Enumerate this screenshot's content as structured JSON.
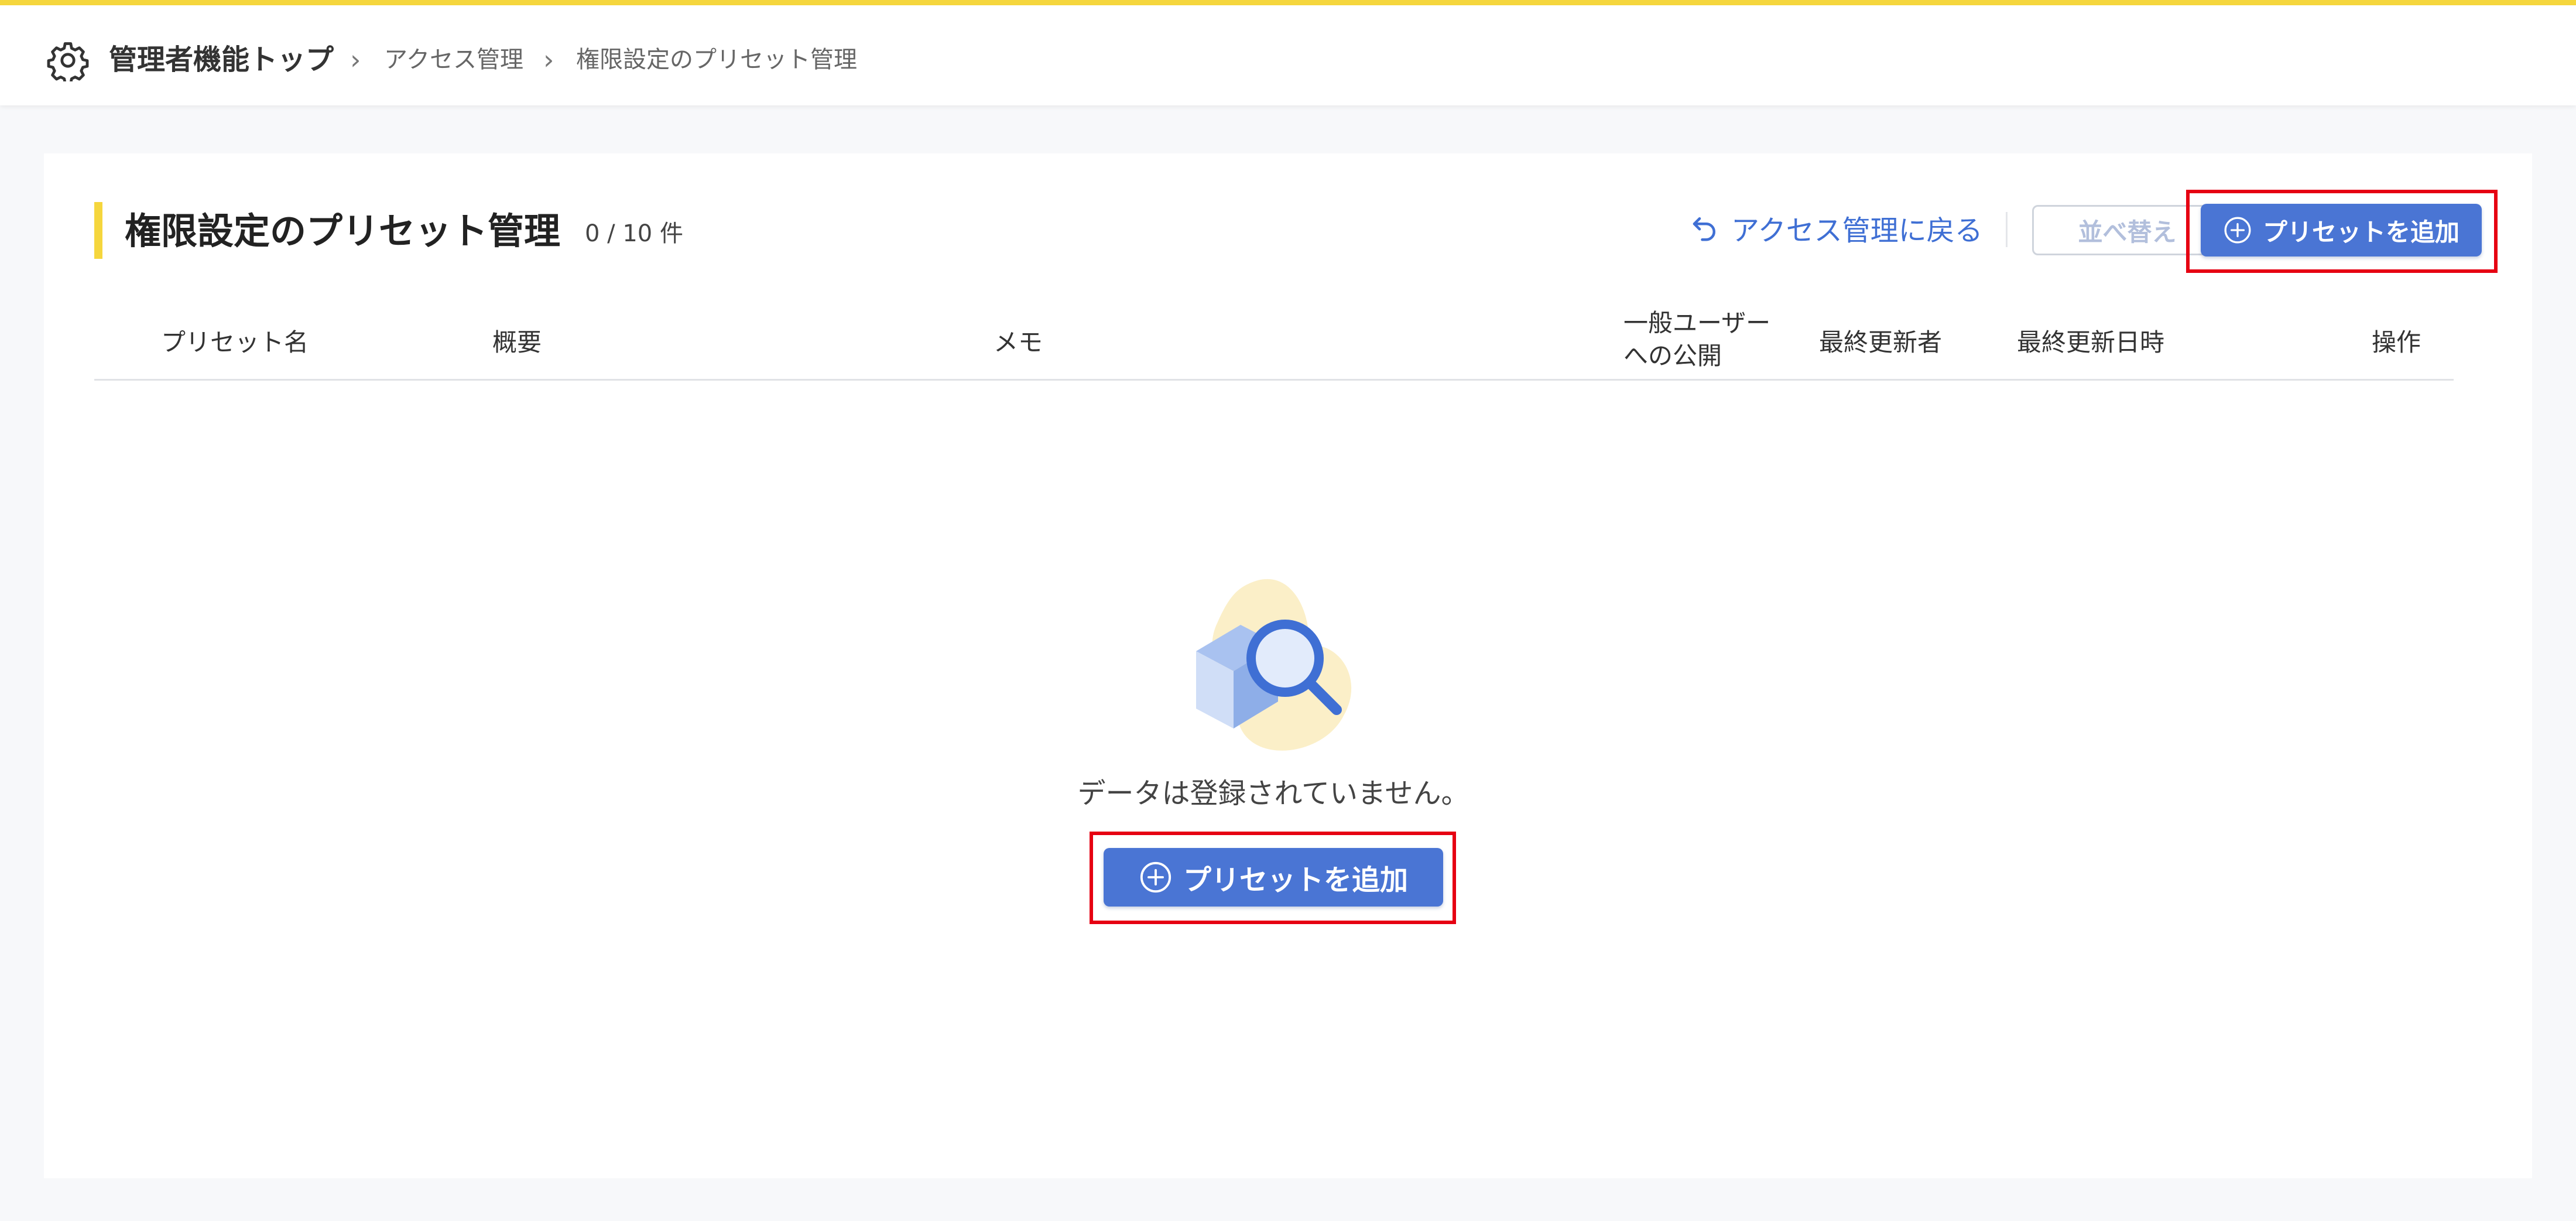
{
  "breadcrumb": {
    "top": "管理者機能トップ",
    "items": [
      "アクセス管理",
      "権限設定のプリセット管理"
    ]
  },
  "page": {
    "title": "権限設定のプリセット管理",
    "count": "0 / 10 件"
  },
  "actions": {
    "back_label": "アクセス管理に戻る",
    "sort_label": "並べ替え",
    "add_label": "プリセットを追加"
  },
  "table": {
    "columns": [
      "プリセット名",
      "概要",
      "メモ",
      "一般ユーザーへの公開",
      "最終更新者",
      "最終更新日時",
      "操作"
    ],
    "public_col_lines": [
      "一般ユーザー",
      "への公開"
    ]
  },
  "empty": {
    "message": "データは登録されていません。",
    "add_label": "プリセットを追加"
  },
  "icons": {
    "settings": "gear-icon",
    "breadcrumb_separator": "chevron-right-icon",
    "back": "undo-arrow-icon",
    "add": "plus-circle-icon",
    "empty": "empty-box-search-illustration"
  },
  "colors": {
    "accent_yellow": "#f5d63d",
    "primary_blue": "#4a75d4",
    "link_blue": "#3f6fd4",
    "highlight_red": "#e60012",
    "background": "#f7f8fa"
  }
}
